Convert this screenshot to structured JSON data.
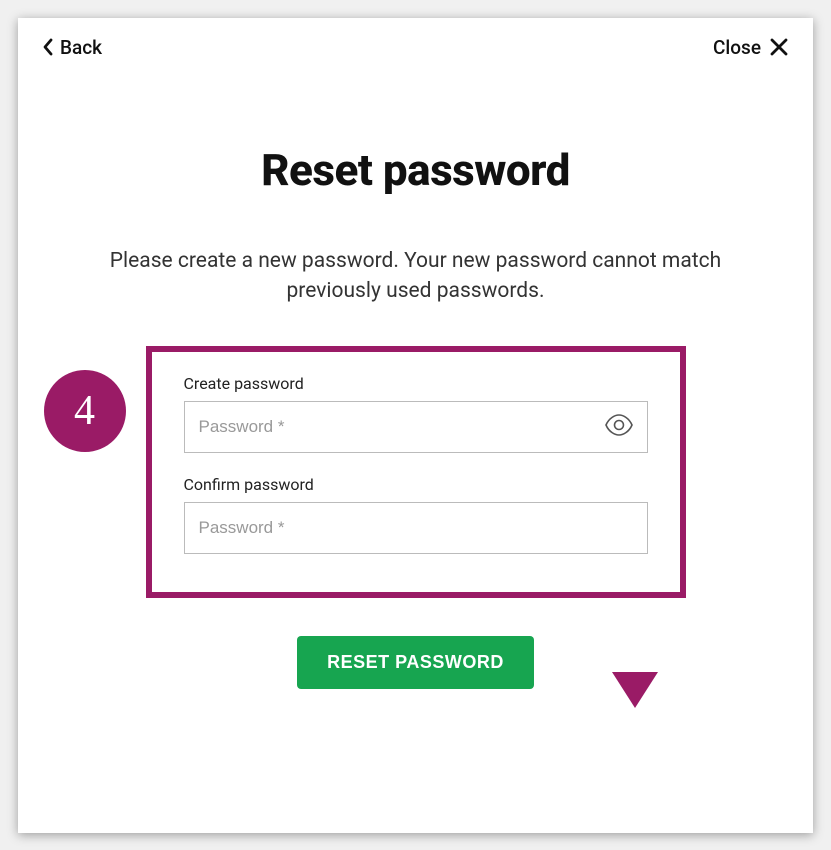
{
  "topbar": {
    "back_label": "Back",
    "close_label": "Close"
  },
  "page": {
    "title": "Reset password",
    "instructions": "Please create a new password. Your new password cannot match previously used passwords."
  },
  "annotations": {
    "step_number": "4"
  },
  "form": {
    "create": {
      "label": "Create password",
      "placeholder": "Password *",
      "value": ""
    },
    "confirm": {
      "label": "Confirm password",
      "placeholder": "Password *",
      "value": ""
    },
    "submit_label": "RESET PASSWORD"
  }
}
